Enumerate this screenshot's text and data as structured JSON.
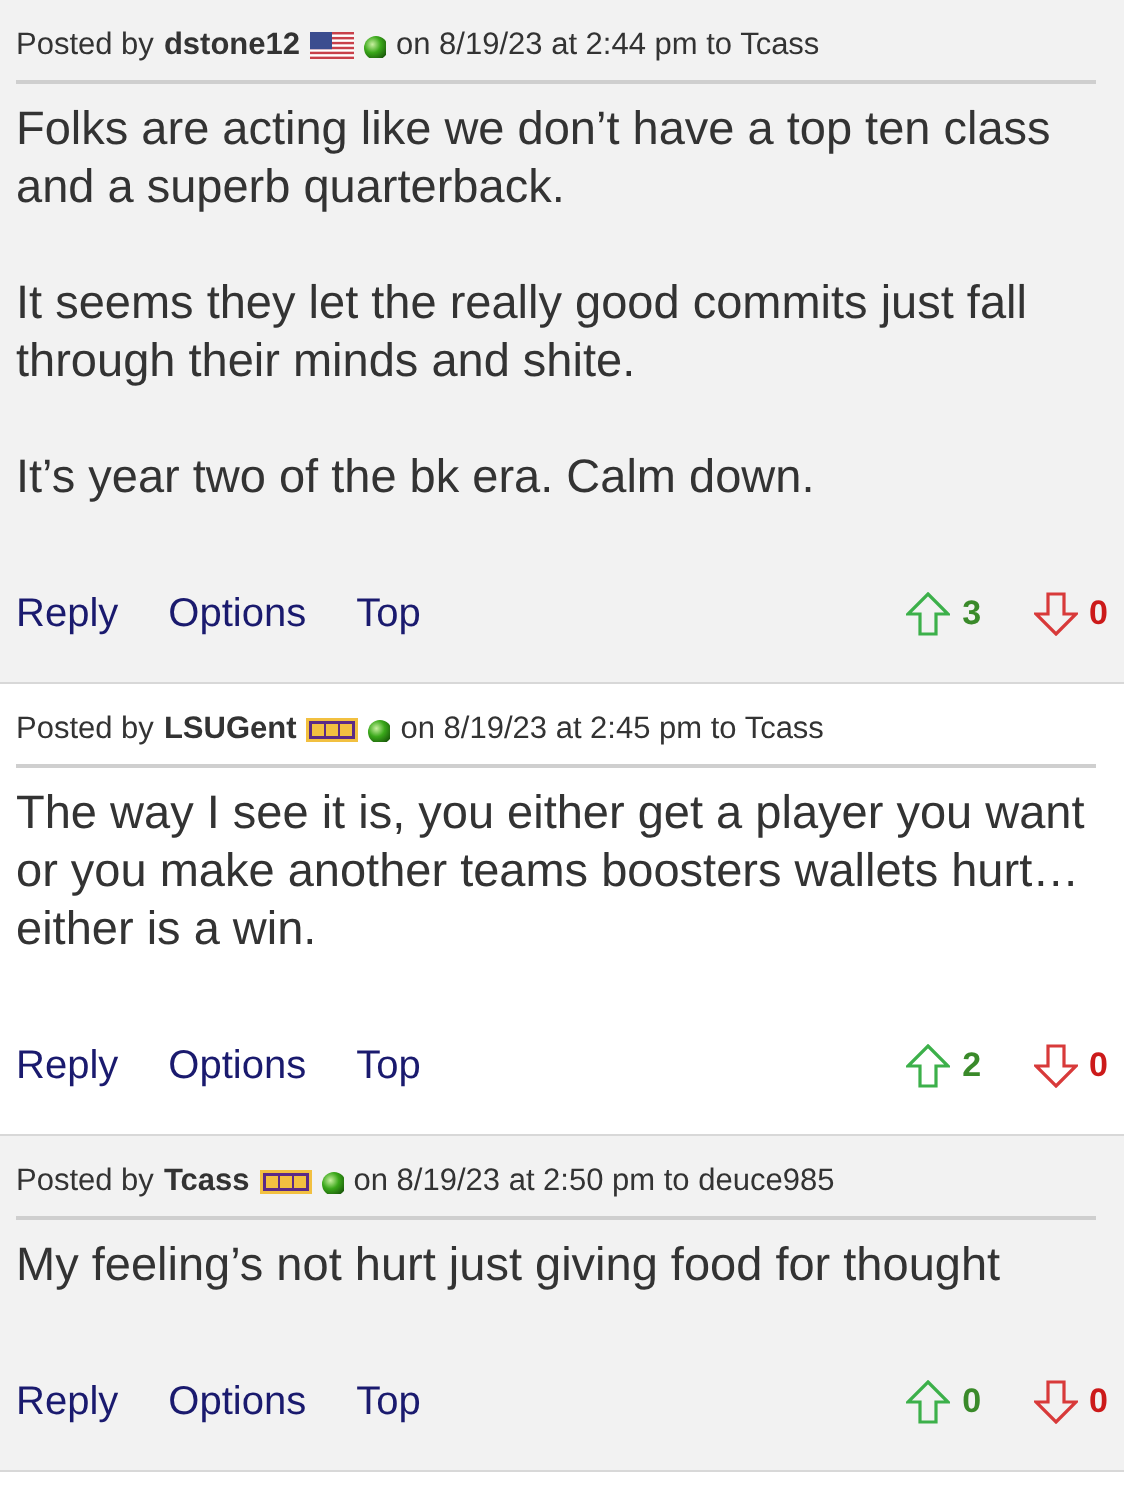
{
  "posts": [
    {
      "prefix": "Posted by",
      "author": "dstone12",
      "badge": {
        "kind": "us"
      },
      "online": true,
      "date": "on 8/19/23 at 2:44 pm to Tcass",
      "shaded": true,
      "paragraphs": [
        "Folks are acting like we don’t have a top ten class and a superb quarterback.",
        "It seems they let the really good commits just fall through their minds and shite.",
        "It’s year two of the bk era. Calm down."
      ],
      "actions": [
        "Reply",
        "Options",
        "Top"
      ],
      "upvotes": "3",
      "downvotes": "0"
    },
    {
      "prefix": "Posted by",
      "author": "LSUGent",
      "badge": {
        "kind": "lsu"
      },
      "online": true,
      "date": "on 8/19/23 at 2:45 pm to Tcass",
      "shaded": false,
      "paragraphs": [
        "The way I see it is, you either get a player you want or you make another teams boosters wallets hurt… either is a win."
      ],
      "actions": [
        "Reply",
        "Options",
        "Top"
      ],
      "upvotes": "2",
      "downvotes": "0"
    },
    {
      "prefix": "Posted by",
      "author": "Tcass",
      "badge": {
        "kind": "lsu"
      },
      "online": true,
      "date": "on 8/19/23 at 2:50 pm to deuce985",
      "shaded": true,
      "paragraphs": [
        "My feeling’s not hurt just giving food for thought"
      ],
      "actions": [
        "Reply",
        "Options",
        "Top"
      ],
      "upvotes": "0",
      "downvotes": "0"
    }
  ]
}
